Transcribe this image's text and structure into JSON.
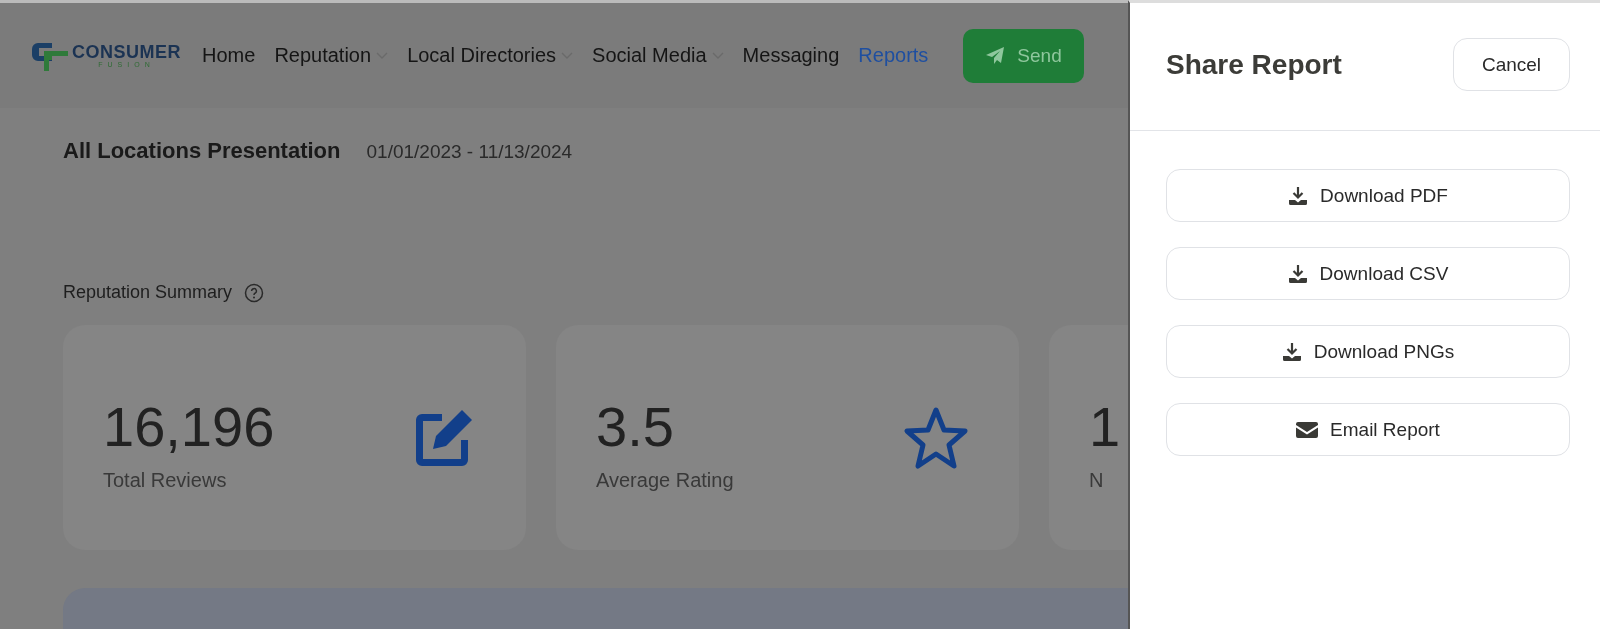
{
  "logo": {
    "name": "CONSUMER",
    "tagline": "FUSION"
  },
  "nav": [
    {
      "label": "Home",
      "dropdown": false,
      "selected": false
    },
    {
      "label": "Reputation",
      "dropdown": true,
      "selected": false
    },
    {
      "label": "Local Directories",
      "dropdown": true,
      "selected": false
    },
    {
      "label": "Social Media",
      "dropdown": true,
      "selected": false
    },
    {
      "label": "Messaging",
      "dropdown": false,
      "selected": false
    },
    {
      "label": "Reports",
      "dropdown": false,
      "selected": true
    }
  ],
  "send_button": "Send",
  "report": {
    "title": "All Locations Presentation",
    "date_range": "01/01/2023 - 11/13/2024"
  },
  "section": {
    "title": "Reputation Summary"
  },
  "cards": [
    {
      "value": "16,196",
      "label": "Total Reviews",
      "kind": "edit"
    },
    {
      "value": "3.5",
      "label": "Average Rating",
      "kind": "star"
    },
    {
      "value": "1",
      "label": "N",
      "kind": "plain"
    }
  ],
  "drawer": {
    "title": "Share Report",
    "cancel": "Cancel",
    "actions": [
      {
        "label": "Download PDF",
        "kind": "download"
      },
      {
        "label": "Download CSV",
        "kind": "download"
      },
      {
        "label": "Download PNGs",
        "kind": "download"
      },
      {
        "label": "Email Report",
        "kind": "email"
      }
    ]
  }
}
